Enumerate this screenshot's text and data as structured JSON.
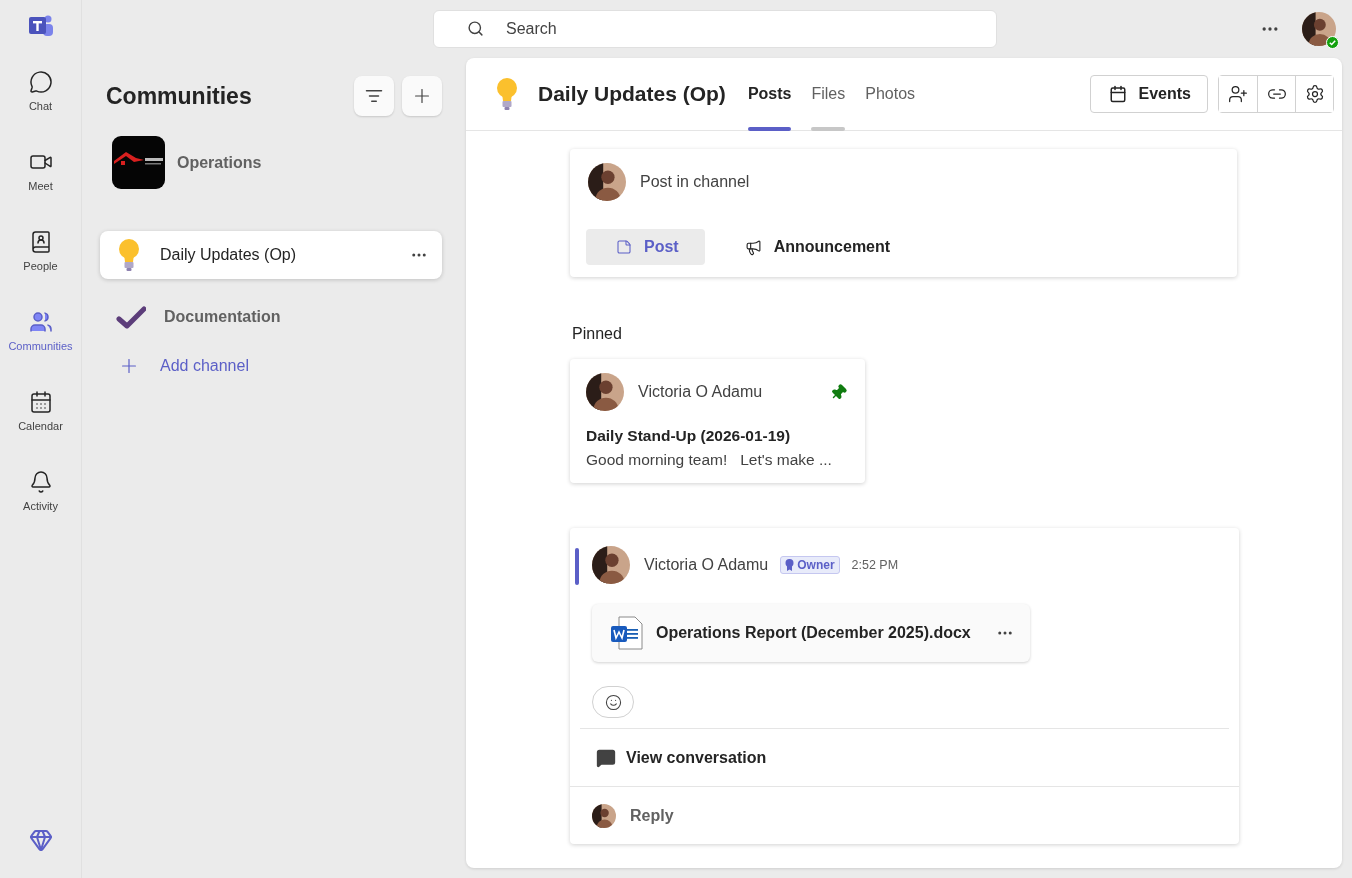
{
  "rail": {
    "items": [
      {
        "label": "Chat",
        "kind": "chat",
        "selected": false
      },
      {
        "label": "Meet",
        "kind": "meet",
        "selected": false
      },
      {
        "label": "People",
        "kind": "people",
        "selected": false
      },
      {
        "label": "Communities",
        "kind": "communities",
        "selected": true
      },
      {
        "label": "Calendar",
        "kind": "calendar",
        "selected": false
      },
      {
        "label": "Activity",
        "kind": "activity",
        "selected": false
      }
    ]
  },
  "search": {
    "placeholder": "Search"
  },
  "sidebar": {
    "title": "Communities",
    "community": {
      "name": "Operations"
    },
    "channels": [
      {
        "name": "Daily Updates (Op)",
        "kind": "bulb",
        "selected": true
      },
      {
        "name": "Documentation",
        "kind": "check",
        "selected": false
      }
    ],
    "add_channel": "Add channel"
  },
  "channel": {
    "title": "Daily Updates (Op)",
    "tabs": [
      {
        "label": "Posts",
        "selected": true,
        "hovered": false
      },
      {
        "label": "Files",
        "selected": false,
        "hovered": true
      },
      {
        "label": "Photos",
        "selected": false,
        "hovered": false
      }
    ],
    "events_button": "Events"
  },
  "compose": {
    "placeholder": "Post in channel",
    "modes": [
      {
        "label": "Post",
        "kind": "post",
        "selected": true
      },
      {
        "label": "Announcement",
        "kind": "announcement",
        "selected": false
      }
    ]
  },
  "pinned": {
    "heading": "Pinned",
    "author": "Victoria O Adamu",
    "title": "Daily Stand-Up (2026-01-19)",
    "preview": "Good morning team!   Let's make ..."
  },
  "post": {
    "author": "Victoria O Adamu",
    "badge": "Owner",
    "time": "2:52 PM",
    "attachment": "Operations Report (December 2025).docx",
    "view_conversation": "View conversation",
    "reply": "Reply"
  }
}
